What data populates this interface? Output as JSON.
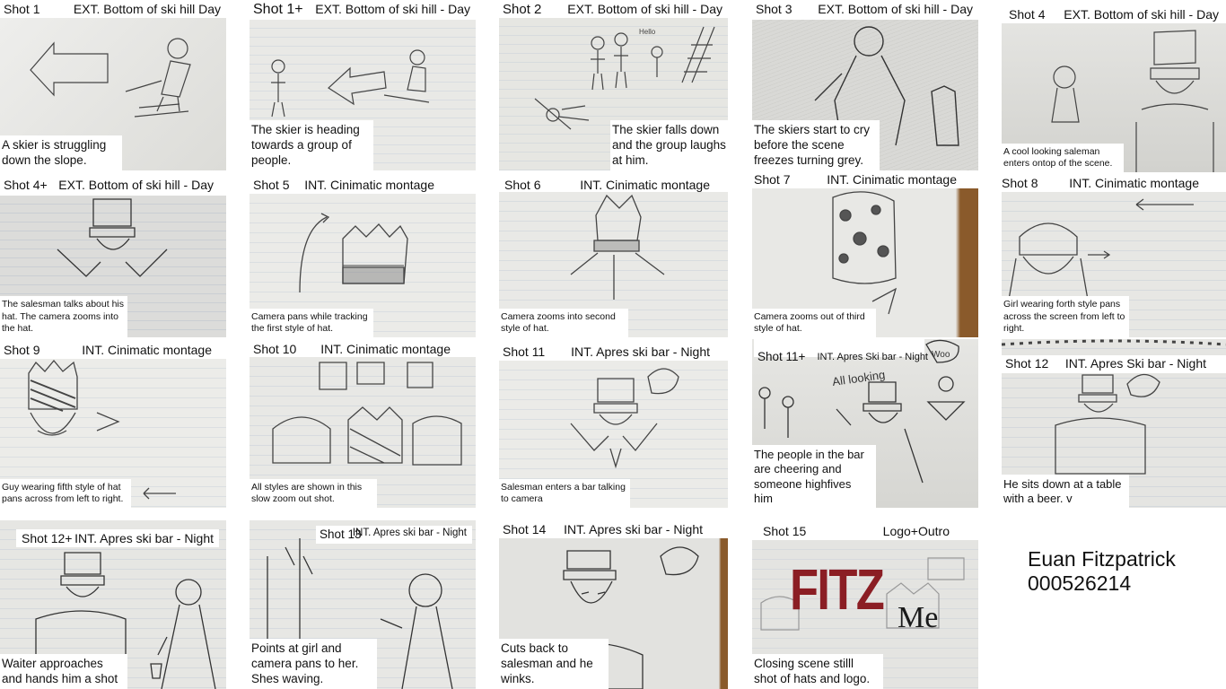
{
  "panels": [
    {
      "shot": "Shot 1",
      "scene": "EXT. Bottom of ski hill Day",
      "caption": "A skier is struggling down the slope."
    },
    {
      "shot": "Shot 1+",
      "scene": "EXT. Bottom of ski hill - Day",
      "caption": "The skier is heading towards a group of people."
    },
    {
      "shot": "Shot 2",
      "scene": "EXT. Bottom of ski hill - Day",
      "caption": "The skier falls down and the group laughs at him."
    },
    {
      "shot": "Shot 3",
      "scene": "EXT. Bottom of ski hill - Day",
      "caption": "The skiers start to cry before the scene freezes turning grey."
    },
    {
      "shot": "Shot 4",
      "scene": "EXT. Bottom of ski hill - Day",
      "caption": "A cool looking saleman enters ontop of the scene."
    },
    {
      "shot": "Shot 4+",
      "scene": "EXT. Bottom of ski hill - Day",
      "caption": "The salesman talks about his hat. The camera zooms into the hat."
    },
    {
      "shot": "Shot 5",
      "scene": "INT. Cinimatic montage",
      "caption": "Camera pans while tracking the first style of hat."
    },
    {
      "shot": "Shot 6",
      "scene": "INT. Cinimatic montage",
      "caption": "Camera zooms into second style of hat."
    },
    {
      "shot": "Shot 7",
      "scene": "INT. Cinimatic montage",
      "caption": "Camera zooms out of third style of hat."
    },
    {
      "shot": "Shot 8",
      "scene": "INT. Cinimatic montage",
      "caption": "Girl wearing forth style pans across the screen from left to right."
    },
    {
      "shot": "Shot 9",
      "scene": "INT. Cinimatic montage",
      "caption": "Guy wearing fifth style of hat pans across from left to right."
    },
    {
      "shot": "Shot 10",
      "scene": "INT. Cinimatic montage",
      "caption": "All styles are shown in this slow zoom out shot."
    },
    {
      "shot": "Shot 11",
      "scene": "INT. Apres ski bar - Night",
      "caption": "Salesman enters a bar talking to camera"
    },
    {
      "shot": "Shot 11+",
      "scene": "INT. Apres Ski bar - Night",
      "caption": "The people in the bar are cheering and someone highfives him"
    },
    {
      "shot": "Shot 12",
      "scene": "INT. Apres Ski bar - Night",
      "caption": "He sits down at  a table with a beer. v"
    },
    {
      "shot": "Shot 12+",
      "scene": "INT. Apres ski bar - Night",
      "caption": "Waiter approaches and hands him a shot"
    },
    {
      "shot": "Shot 13",
      "scene": "INT. Apres ski bar - Night",
      "caption": "Points at girl and camera pans to her. Shes waving."
    },
    {
      "shot": "Shot 14",
      "scene": "INT. Apres ski bar - Night",
      "caption": "Cuts back to salesman and he winks."
    },
    {
      "shot": "Shot 15",
      "scene": "Logo+Outro",
      "caption": "Closing scene stilll shot of hats and logo."
    }
  ],
  "sketch_text": {
    "hello": "Hello",
    "all_looking": "All looking",
    "woo": "Woo"
  },
  "logo": {
    "main": "FITZ",
    "sub": "Me",
    "color": "#8b1e24"
  },
  "credits": {
    "name": "Euan Fitzpatrick",
    "id": "000526214"
  }
}
